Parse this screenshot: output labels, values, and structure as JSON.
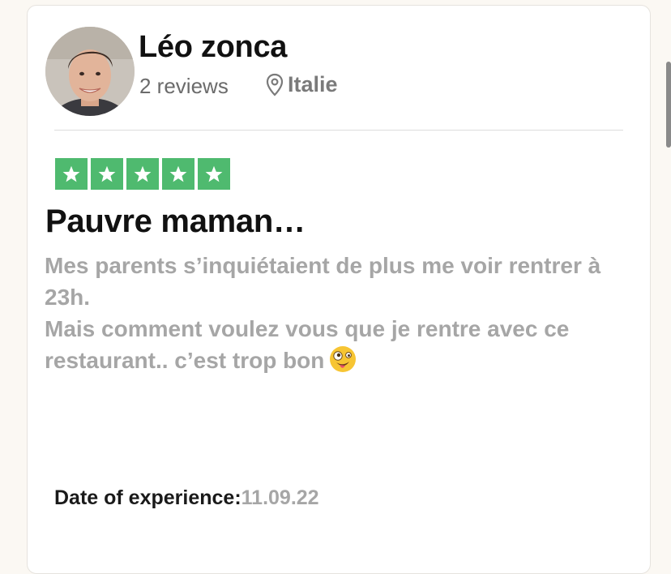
{
  "reviewer": {
    "name": "Léo zonca",
    "review_count": "2 reviews",
    "location": "Italie",
    "avatar_icon": "person-photo-icon",
    "location_icon": "map-pin-icon"
  },
  "review": {
    "rating": 5,
    "rating_max": 5,
    "star_color": "#4fba6f",
    "title": "Pauvre maman…",
    "body_line_1": "Mes parents s’inquiétaient de plus me voir rentrer à 23h.",
    "body_line_2": "Mais comment voulez vous que je rentre avec ce restaurant.. c’est trop bon",
    "emoji_icon": "zany-face-emoji-icon"
  },
  "experience": {
    "label": "Date of experience:",
    "date": "11.09.22"
  }
}
